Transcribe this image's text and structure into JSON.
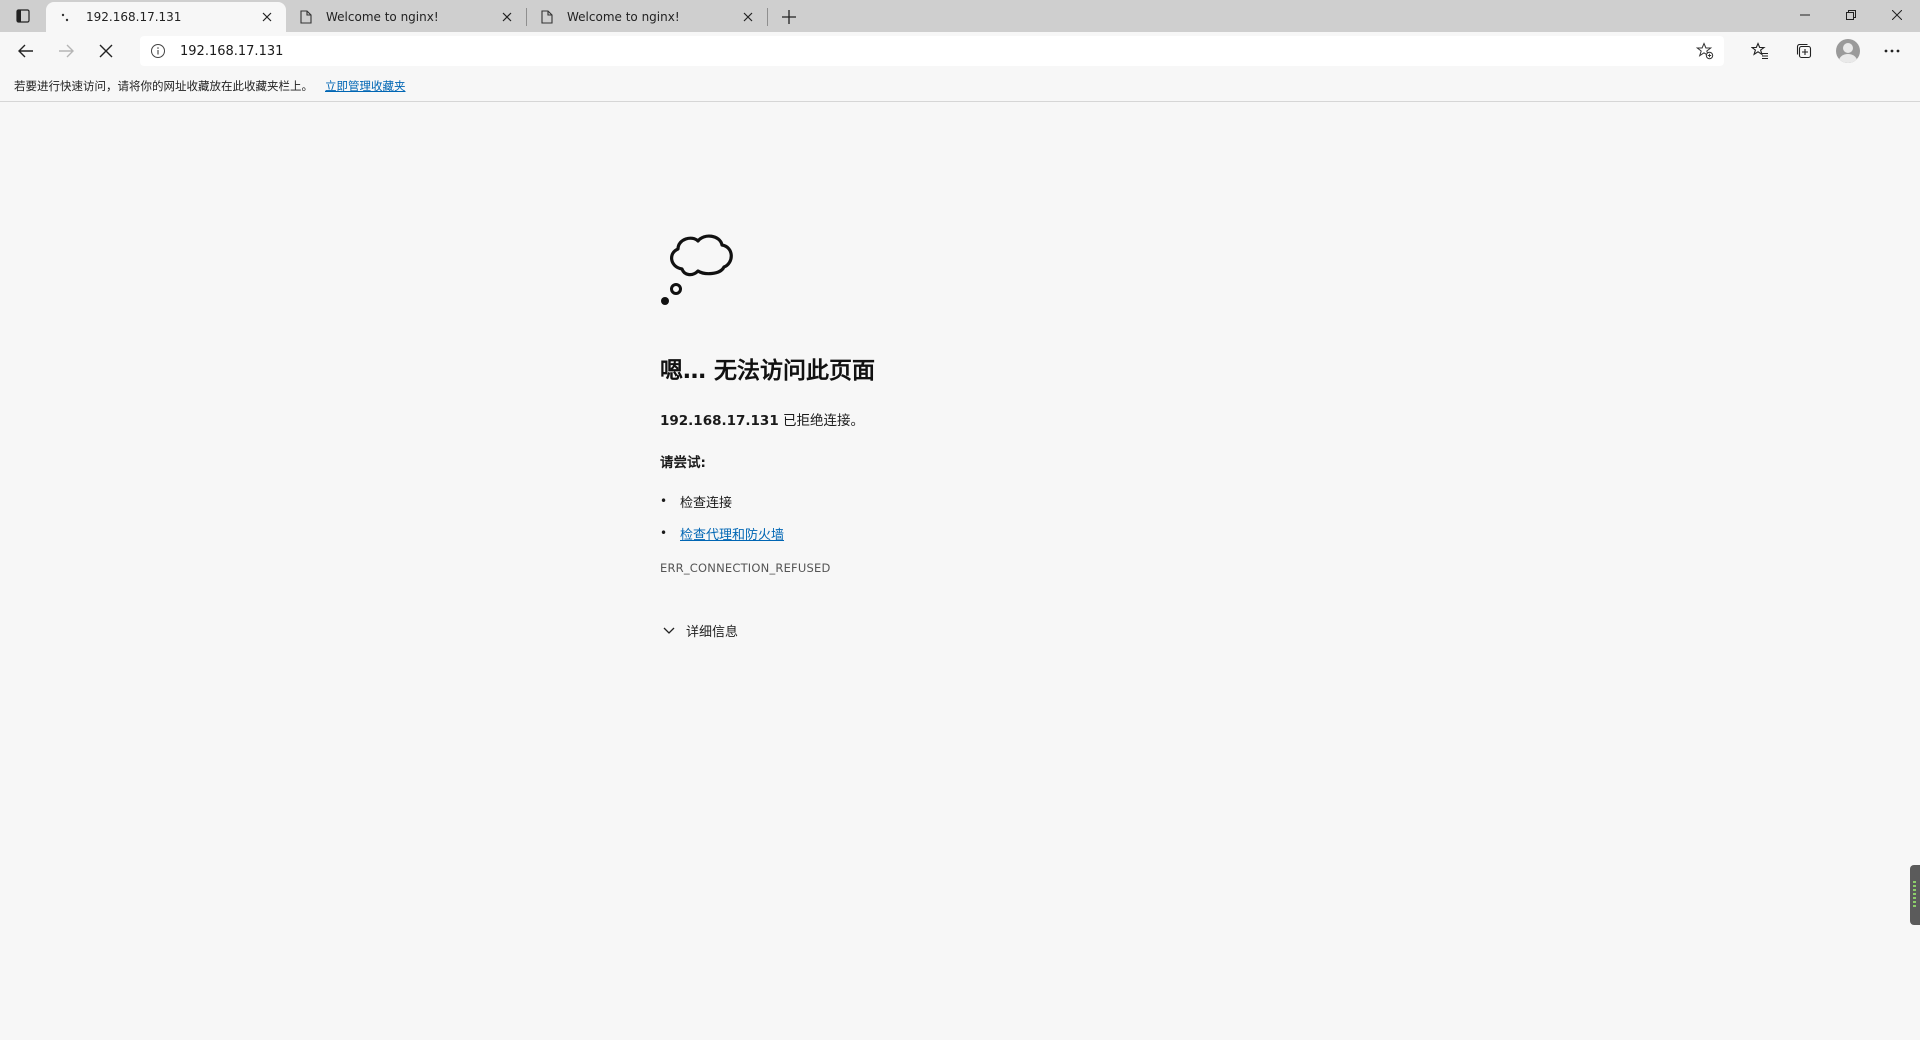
{
  "tabs": [
    {
      "title": "192.168.17.131",
      "active": true,
      "icon": "loading-icon"
    },
    {
      "title": "Welcome to nginx!",
      "active": false,
      "icon": "page-icon"
    },
    {
      "title": "Welcome to nginx!",
      "active": false,
      "icon": "page-icon"
    }
  ],
  "address_bar": {
    "url": "192.168.17.131"
  },
  "favorites_bar": {
    "message": "若要进行快速访问，请将你的网址收藏放在此收藏夹栏上。",
    "link_label": "立即管理收藏夹"
  },
  "error_page": {
    "title": "嗯… 无法访问此页面",
    "host": "192.168.17.131",
    "description_suffix": " 已拒绝连接。",
    "try_label": "请尝试:",
    "suggestions": [
      {
        "label": "检查连接",
        "link": false
      },
      {
        "label": "检查代理和防火墙",
        "link": true
      }
    ],
    "error_code": "ERR_CONNECTION_REFUSED",
    "details_label": "详细信息"
  },
  "colors": {
    "link": "#0066b4",
    "tabstrip": "#cfcfcf",
    "page_bg": "#f7f7f7"
  }
}
